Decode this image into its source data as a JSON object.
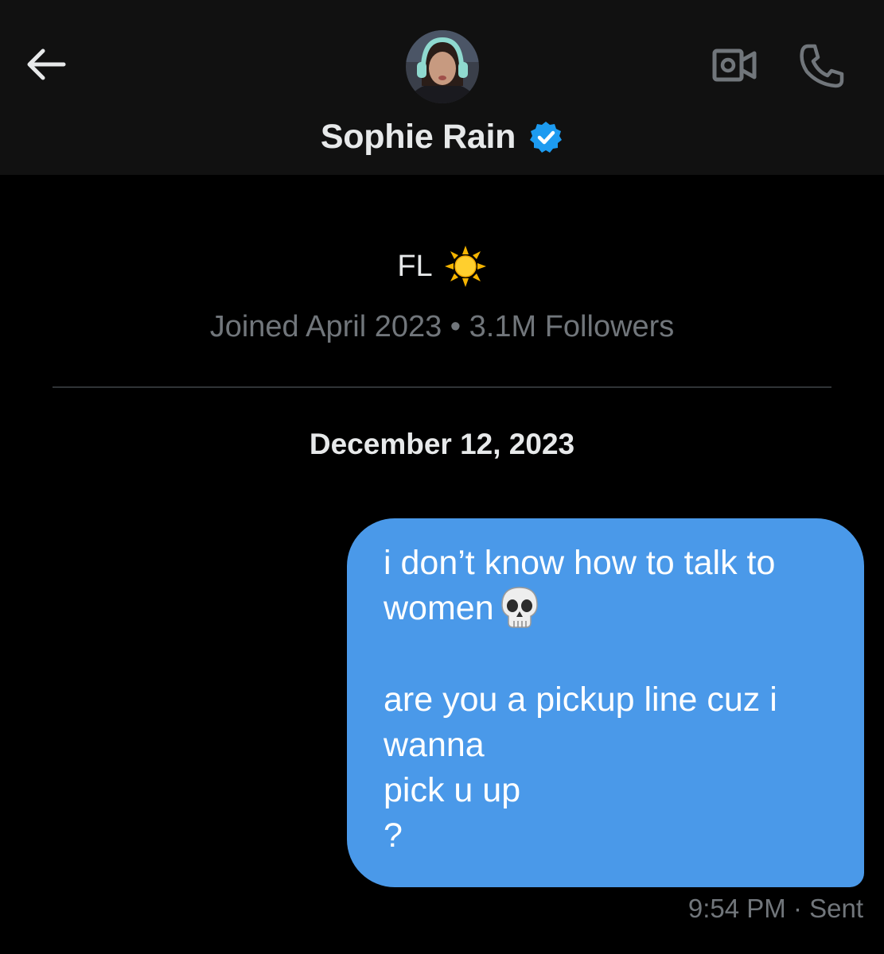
{
  "header": {
    "back_icon": "arrow-left-icon",
    "contact_name": "Sophie Rain",
    "verified_icon": "verified-badge-icon",
    "video_icon": "video-camera-icon",
    "call_icon": "phone-icon",
    "background": "#111111"
  },
  "profile": {
    "bio_text": "FL",
    "bio_emoji_icon": "sun-emoji-icon",
    "joined": "Joined April 2023",
    "separator": " • ",
    "followers": "3.1M Followers"
  },
  "conversation": {
    "date": "December 12, 2023",
    "message": {
      "text_line1": "i don’t know how to talk to\nwomen",
      "emoji_icon": "skull-emoji-icon",
      "text_rest": "\n\nare you a pickup line cuz i\nwanna\npick u up\n?",
      "time": "9:54 PM",
      "status_separator": " · ",
      "status": "Sent",
      "bubble_color": "#4a99e9"
    }
  },
  "colors": {
    "background": "#000000",
    "secondary_text": "#71767b",
    "verified_blue": "#1d9bf0"
  }
}
